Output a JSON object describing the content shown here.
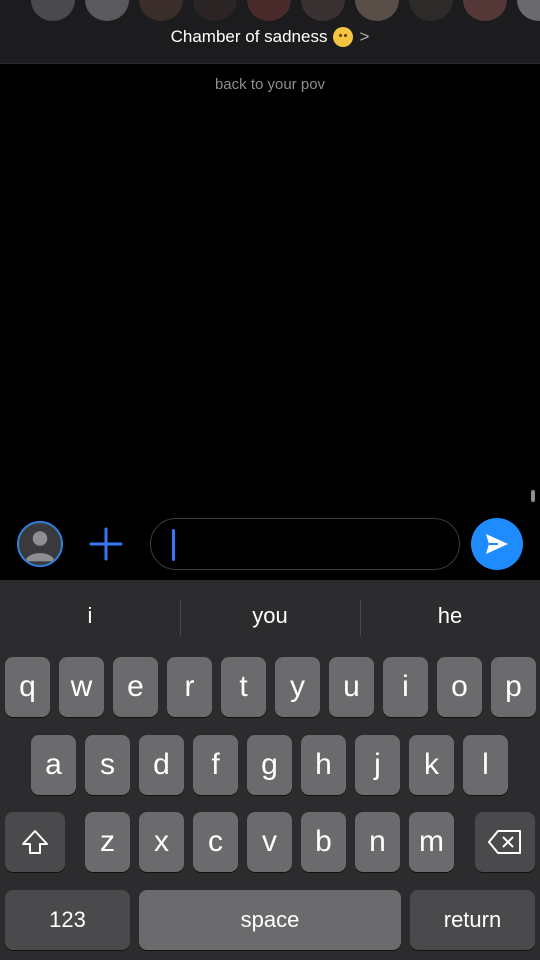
{
  "header": {
    "title": "Chamber of sadness",
    "title_emoji": "pleading-face-emoji",
    "chevron": ">",
    "avatars": [
      "#4a4a4c",
      "#5a5a5c",
      "#3b2e2a",
      "#2a2424",
      "#4a2a2a",
      "#3a3232",
      "#5a4e48",
      "#2e2a2a",
      "#553838",
      "#6a6a6c",
      "#1e1a1a",
      "#4e4642",
      "#5e5048"
    ]
  },
  "status_line": "back to your pov",
  "composer": {
    "input_value": "",
    "send_icon": "send-arrow-icon",
    "add_icon": "plus-icon",
    "profile_icon": "person-icon",
    "accent": "#1e8cff"
  },
  "keyboard": {
    "suggestions": [
      "i",
      "you",
      "he"
    ],
    "row1": [
      "q",
      "w",
      "e",
      "r",
      "t",
      "y",
      "u",
      "i",
      "o",
      "p"
    ],
    "row2": [
      "a",
      "s",
      "d",
      "f",
      "g",
      "h",
      "j",
      "k",
      "l"
    ],
    "row3": [
      "z",
      "x",
      "c",
      "v",
      "b",
      "n",
      "m"
    ],
    "numbers_label": "123",
    "space_label": "space",
    "return_label": "return",
    "shift_icon": "shift-icon",
    "delete_icon": "delete-icon"
  }
}
